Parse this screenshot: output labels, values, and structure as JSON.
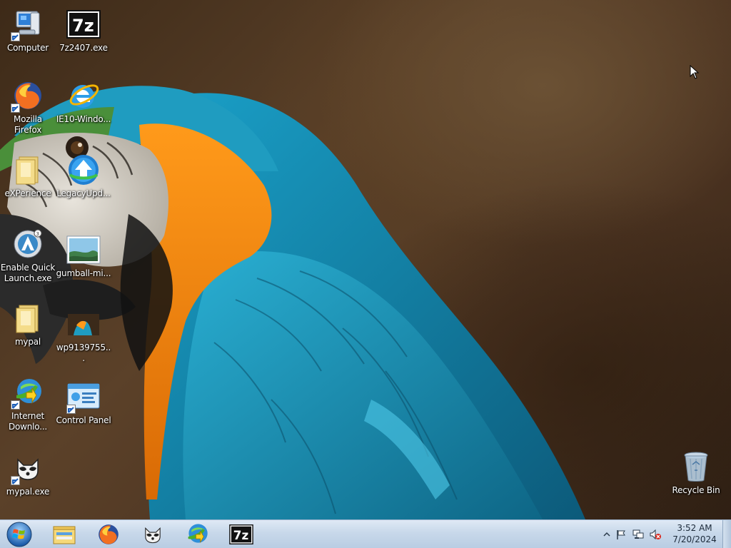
{
  "desktop": {
    "icons": [
      {
        "id": "computer",
        "label": "Computer"
      },
      {
        "id": "7z2407",
        "label": "7z2407.exe"
      },
      {
        "id": "firefox",
        "label": "Mozilla Firefox"
      },
      {
        "id": "ie10",
        "label": "IE10-Windo..."
      },
      {
        "id": "experience",
        "label": "eXPerience"
      },
      {
        "id": "legacyupd",
        "label": "LegacyUpd..."
      },
      {
        "id": "quicklaunch",
        "label": "Enable Quick Launch.exe"
      },
      {
        "id": "gumball",
        "label": "gumball-mi..."
      },
      {
        "id": "mypal-folder",
        "label": "mypal"
      },
      {
        "id": "wp9139755",
        "label": "wp9139755..."
      },
      {
        "id": "idm",
        "label": "Internet Downlo..."
      },
      {
        "id": "controlpanel",
        "label": "Control Panel"
      },
      {
        "id": "mypal-exe",
        "label": "mypal.exe"
      },
      {
        "id": "recyclebin",
        "label": "Recycle Bin"
      }
    ]
  },
  "taskbar": {
    "start_icon": "windows-orb-icon",
    "pinned": [
      {
        "id": "explorer",
        "icon": "folder-icon"
      },
      {
        "id": "firefox",
        "icon": "firefox-icon"
      },
      {
        "id": "mypal",
        "icon": "raccoon-icon"
      },
      {
        "id": "idm",
        "icon": "idm-icon"
      },
      {
        "id": "7zip",
        "icon": "7zip-icon",
        "text": "7z"
      }
    ],
    "tray": {
      "icons": [
        "chevron-up-icon",
        "action-center-flag-icon",
        "network-icon",
        "volume-muted-icon"
      ]
    },
    "clock": {
      "time": "3:52 AM",
      "date": "7/20/2024"
    }
  },
  "icons_text": {
    "sevenzip": "7z"
  },
  "colors": {
    "taskbar": "#c8d8ea",
    "label_text": "#ffffff"
  }
}
